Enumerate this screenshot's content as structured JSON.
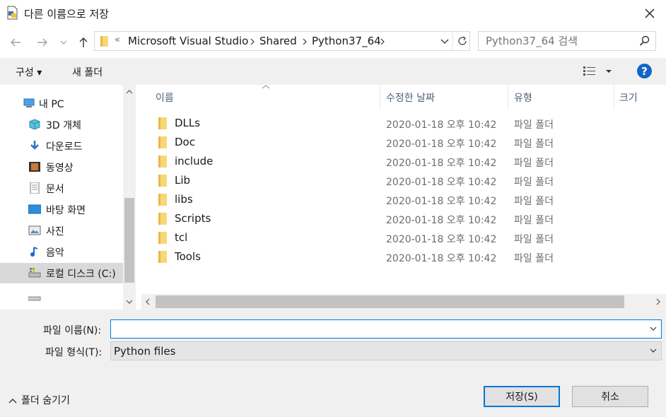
{
  "window": {
    "title": "다른 이름으로 저장"
  },
  "address": {
    "overflow": "«",
    "crumbs": [
      "Microsoft Visual Studio",
      "Shared",
      "Python37_64"
    ]
  },
  "search": {
    "placeholder": "Python37_64 검색"
  },
  "toolbar": {
    "organize": "구성 ▾",
    "new_folder": "새 폴더"
  },
  "sidebar": {
    "items": [
      {
        "label": "내 PC",
        "icon": "pc-icon"
      },
      {
        "label": "3D 개체",
        "icon": "cube-3d-icon"
      },
      {
        "label": "다운로드",
        "icon": "download-icon"
      },
      {
        "label": "동영상",
        "icon": "video-icon"
      },
      {
        "label": "문서",
        "icon": "document-icon"
      },
      {
        "label": "바탕 화면",
        "icon": "desktop-icon"
      },
      {
        "label": "사진",
        "icon": "picture-icon"
      },
      {
        "label": "음악",
        "icon": "music-icon"
      },
      {
        "label": "로컬 디스크 (C:)",
        "icon": "local-disk-icon"
      }
    ]
  },
  "columns": {
    "name": "이름",
    "modified": "수정한 날짜",
    "type": "유형",
    "size": "크기"
  },
  "files": [
    {
      "name": "DLLs",
      "modified": "2020-01-18 오후 10:42",
      "type": "파일 폴더"
    },
    {
      "name": "Doc",
      "modified": "2020-01-18 오후 10:42",
      "type": "파일 폴더"
    },
    {
      "name": "include",
      "modified": "2020-01-18 오후 10:42",
      "type": "파일 폴더"
    },
    {
      "name": "Lib",
      "modified": "2020-01-18 오후 10:42",
      "type": "파일 폴더"
    },
    {
      "name": "libs",
      "modified": "2020-01-18 오후 10:42",
      "type": "파일 폴더"
    },
    {
      "name": "Scripts",
      "modified": "2020-01-18 오후 10:42",
      "type": "파일 폴더"
    },
    {
      "name": "tcl",
      "modified": "2020-01-18 오후 10:42",
      "type": "파일 폴더"
    },
    {
      "name": "Tools",
      "modified": "2020-01-18 오후 10:42",
      "type": "파일 폴더"
    }
  ],
  "form": {
    "filename_label": "파일 이름(N):",
    "filename_value": "",
    "filetype_label": "파일 형식(T):",
    "filetype_value": "Python files"
  },
  "footer": {
    "hide_folders": "폴더 숨기기",
    "save": "저장(S)",
    "cancel": "취소"
  },
  "colors": {
    "accent": "#0078d7",
    "help": "#1366c5",
    "folder": "#f8d775",
    "selected": "#d9d9d9"
  }
}
